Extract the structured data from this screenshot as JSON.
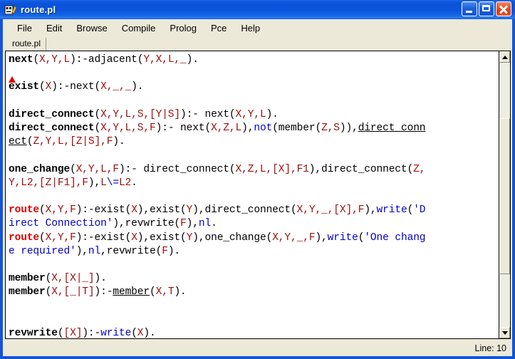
{
  "window": {
    "title": "route.pl",
    "icon": "prolog-app-icon",
    "controls": {
      "minimize": "minimize-button",
      "maximize": "maximize-button",
      "close": "close-button"
    }
  },
  "menubar": {
    "items": [
      {
        "label": "File"
      },
      {
        "label": "Edit"
      },
      {
        "label": "Browse"
      },
      {
        "label": "Compile"
      },
      {
        "label": "Prolog"
      },
      {
        "label": "Pce"
      },
      {
        "label": "Help"
      }
    ]
  },
  "tabs": [
    {
      "label": "route.pl",
      "active": true
    }
  ],
  "editor": {
    "marker": {
      "type": "caret-marker",
      "color": "#e00000",
      "line": 2
    },
    "lines": [
      [
        {
          "t": "next",
          "s": "k"
        },
        {
          "t": "(",
          "s": "pl"
        },
        {
          "t": "X,Y,L",
          "s": "v"
        },
        {
          "t": "):-adjacent(",
          "s": "pl"
        },
        {
          "t": "Y,X,L,_",
          "s": "v"
        },
        {
          "t": ").",
          "s": "pl"
        }
      ],
      [],
      [
        {
          "t": "exist",
          "s": "k"
        },
        {
          "t": "(",
          "s": "pl"
        },
        {
          "t": "X",
          "s": "v"
        },
        {
          "t": "):-next(",
          "s": "pl"
        },
        {
          "t": "X,_,_",
          "s": "v"
        },
        {
          "t": ").",
          "s": "pl"
        }
      ],
      [],
      [
        {
          "t": "direct_connect",
          "s": "k"
        },
        {
          "t": "(",
          "s": "pl"
        },
        {
          "t": "X,Y,L,S,[Y|S]",
          "s": "v"
        },
        {
          "t": "):- next(",
          "s": "pl"
        },
        {
          "t": "X,Y,L",
          "s": "v"
        },
        {
          "t": ").",
          "s": "pl"
        }
      ],
      [
        {
          "t": "direct_connect",
          "s": "k"
        },
        {
          "t": "(",
          "s": "pl"
        },
        {
          "t": "X,Y,L,S,F",
          "s": "v"
        },
        {
          "t": "):- next(",
          "s": "pl"
        },
        {
          "t": "X,Z,L",
          "s": "v"
        },
        {
          "t": "),",
          "s": "pl"
        },
        {
          "t": "not",
          "s": "b"
        },
        {
          "t": "(member(",
          "s": "pl"
        },
        {
          "t": "Z,S",
          "s": "v"
        },
        {
          "t": ")),",
          "s": "pl"
        },
        {
          "t": "direct_conn",
          "s": "u"
        }
      ],
      [
        {
          "t": "ect",
          "s": "u"
        },
        {
          "t": "(",
          "s": "pl"
        },
        {
          "t": "Z,Y,L,[Z|S],F",
          "s": "v"
        },
        {
          "t": ").",
          "s": "pl"
        }
      ],
      [],
      [
        {
          "t": "one_change",
          "s": "k"
        },
        {
          "t": "(",
          "s": "pl"
        },
        {
          "t": "X,Y,L,F",
          "s": "v"
        },
        {
          "t": "):- direct_connect(",
          "s": "pl"
        },
        {
          "t": "X,Z,L,[X],F1",
          "s": "v"
        },
        {
          "t": "),direct_connect(",
          "s": "pl"
        },
        {
          "t": "Z,",
          "s": "v"
        }
      ],
      [
        {
          "t": "Y,L2,[Z|F1],F",
          "s": "v"
        },
        {
          "t": "),",
          "s": "pl"
        },
        {
          "t": "L",
          "s": "v"
        },
        {
          "t": "\\=",
          "s": "b"
        },
        {
          "t": "L2",
          "s": "v"
        },
        {
          "t": ".",
          "s": "pl"
        }
      ],
      [],
      [
        {
          "t": "route",
          "s": "kr"
        },
        {
          "t": "(",
          "s": "pl"
        },
        {
          "t": "X,Y,F",
          "s": "v"
        },
        {
          "t": "):-exist(",
          "s": "pl"
        },
        {
          "t": "X",
          "s": "v"
        },
        {
          "t": "),exist(",
          "s": "pl"
        },
        {
          "t": "Y",
          "s": "v"
        },
        {
          "t": "),direct_connect(",
          "s": "pl"
        },
        {
          "t": "X,Y,_,[X],F",
          "s": "v"
        },
        {
          "t": "),",
          "s": "pl"
        },
        {
          "t": "write",
          "s": "b"
        },
        {
          "t": "(",
          "s": "pl"
        },
        {
          "t": "'D",
          "s": "b"
        }
      ],
      [
        {
          "t": "irect Connection'",
          "s": "b"
        },
        {
          "t": "),revwrite(",
          "s": "pl"
        },
        {
          "t": "F",
          "s": "v"
        },
        {
          "t": "),",
          "s": "pl"
        },
        {
          "t": "nl",
          "s": "b"
        },
        {
          "t": ".",
          "s": "pl"
        }
      ],
      [
        {
          "t": "route",
          "s": "kr"
        },
        {
          "t": "(",
          "s": "pl"
        },
        {
          "t": "X,Y,F",
          "s": "v"
        },
        {
          "t": "):-exist(",
          "s": "pl"
        },
        {
          "t": "X",
          "s": "v"
        },
        {
          "t": "),exist(",
          "s": "pl"
        },
        {
          "t": "Y",
          "s": "v"
        },
        {
          "t": "),one_change(",
          "s": "pl"
        },
        {
          "t": "X,Y,_,F",
          "s": "v"
        },
        {
          "t": "),",
          "s": "pl"
        },
        {
          "t": "write",
          "s": "b"
        },
        {
          "t": "(",
          "s": "pl"
        },
        {
          "t": "'One chang",
          "s": "b"
        }
      ],
      [
        {
          "t": "e required'",
          "s": "b"
        },
        {
          "t": "),",
          "s": "pl"
        },
        {
          "t": "nl",
          "s": "b"
        },
        {
          "t": ",revwrite(",
          "s": "pl"
        },
        {
          "t": "F",
          "s": "v"
        },
        {
          "t": ").",
          "s": "pl"
        }
      ],
      [],
      [
        {
          "t": "member",
          "s": "k"
        },
        {
          "t": "(",
          "s": "pl"
        },
        {
          "t": "X,[X|_]",
          "s": "v"
        },
        {
          "t": ").",
          "s": "pl"
        }
      ],
      [
        {
          "t": "member",
          "s": "k"
        },
        {
          "t": "(",
          "s": "pl"
        },
        {
          "t": "X,[_|T]",
          "s": "v"
        },
        {
          "t": "):-",
          "s": "pl"
        },
        {
          "t": "member",
          "s": "u"
        },
        {
          "t": "(",
          "s": "pl"
        },
        {
          "t": "X,T",
          "s": "v"
        },
        {
          "t": ").",
          "s": "pl"
        }
      ],
      [],
      [],
      [
        {
          "t": "revwrite",
          "s": "k"
        },
        {
          "t": "(",
          "s": "pl"
        },
        {
          "t": "[X]",
          "s": "v"
        },
        {
          "t": "):-",
          "s": "pl"
        },
        {
          "t": "write",
          "s": "b"
        },
        {
          "t": "(",
          "s": "pl"
        },
        {
          "t": "X",
          "s": "v"
        },
        {
          "t": ").",
          "s": "pl"
        }
      ]
    ]
  },
  "scrollbar": {
    "up_arrow": "scroll-up-arrow",
    "down_arrow": "scroll-down-arrow",
    "thumb": "scroll-thumb"
  },
  "statusbar": {
    "text": "Line: 10"
  },
  "colors": {
    "titlebar": "#0a52d6",
    "chrome": "#ece9d8",
    "variable": "#9c0d0d",
    "builtin": "#0000cc",
    "keyword": "#000000",
    "route_head": "#dd0000",
    "marker": "#e00000"
  }
}
